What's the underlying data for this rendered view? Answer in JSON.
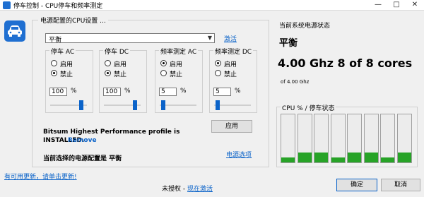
{
  "window": {
    "title": "停车控制 - CPU停车和频率测定",
    "controls": [
      "—",
      "□",
      "✕"
    ]
  },
  "config": {
    "group_label": "电源配置的CPU设置 ...",
    "selected_plan": "平衡",
    "activate_link": "激活",
    "panels": [
      {
        "title": "停车 AC",
        "options": [
          "启用",
          "禁止"
        ],
        "selected": 1,
        "value": "100",
        "unit": "%",
        "slider_fraction": 0.9
      },
      {
        "title": "停车 DC",
        "options": [
          "启用",
          "禁止"
        ],
        "selected": 1,
        "value": "100",
        "unit": "%",
        "slider_fraction": 0.9
      },
      {
        "title": "频率测定 AC",
        "options": [
          "启用",
          "禁止"
        ],
        "selected": 0,
        "value": "5",
        "unit": "%",
        "slider_fraction": 0.05
      },
      {
        "title": "频率测定 DC",
        "options": [
          "启用",
          "禁止"
        ],
        "selected": 0,
        "value": "5",
        "unit": "%",
        "slider_fraction": 0.05
      }
    ],
    "apply_button": "应用",
    "bitsum_line1": "Bitsum Highest Performance profile is",
    "bitsum_installed": "INSTALLED.",
    "bitsum_remove": "Remove",
    "current_profile": "当前选择的电源配置是 平衡",
    "power_options_link": "电源选项"
  },
  "status": {
    "heading": "当前系统电源状态",
    "plan": "平衡",
    "cpu_summary": "4.00 Ghz   8 of 8 cores",
    "cpu_small": "of 4.00 Ghz",
    "graph_label": "CPU % / 停车状态",
    "core_load_percent": [
      10,
      20,
      20,
      10,
      20,
      20,
      10,
      20
    ]
  },
  "footer": {
    "update_link": "有可用更新，请单击更新!",
    "unlicensed": "未授权 - ",
    "activate_link": "现在激活",
    "ok_button": "确定",
    "cancel_button": "取消"
  },
  "colors": {
    "accent": "#0b63c9",
    "bar_fill": "#27a327"
  },
  "icons": {
    "app_icon": "car-icon"
  }
}
